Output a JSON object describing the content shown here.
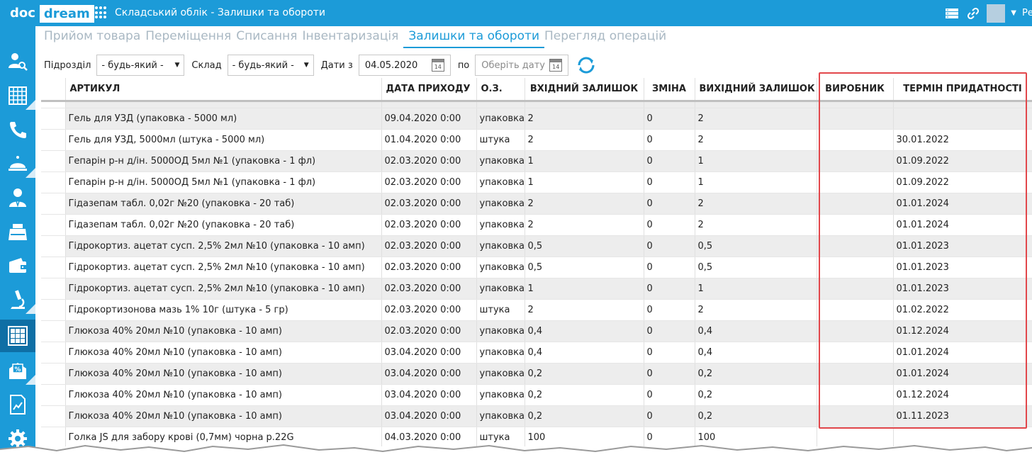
{
  "header": {
    "logo_doc": "doc",
    "logo_dream": "dream",
    "title": "Складський облік - Залишки та обороти",
    "user": "Ре"
  },
  "sidebar": {
    "items": [
      "user-search-icon",
      "calendar-grid-icon",
      "phone-icon",
      "service-bell-icon",
      "doctor-icon",
      "register-icon",
      "wallet-icon",
      "microscope-icon",
      "warehouse-icon",
      "discount-mail-icon",
      "report-icon",
      "gear-icon"
    ],
    "active_index": 8
  },
  "tabs": [
    {
      "label": "Прийом товара",
      "active": false
    },
    {
      "label": "Переміщення",
      "active": false
    },
    {
      "label": "Списання",
      "active": false
    },
    {
      "label": "Інвентаризація",
      "active": false
    },
    {
      "label": "Залишки та обороти",
      "active": true
    },
    {
      "label": "Перегляд операцій",
      "active": false
    }
  ],
  "filters": {
    "division_label": "Підрозділ",
    "division_value": "- будь-який -",
    "warehouse_label": "Склад",
    "warehouse_value": "- будь-який -",
    "date_from_label": "Дати з",
    "date_from_value": "04.05.2020",
    "date_to_label": "по",
    "date_to_placeholder": "Оберіть дату"
  },
  "table": {
    "columns": [
      "АРТИКУЛ",
      "ДАТА ПРИХОДУ",
      "О.З.",
      "ВХІДНИЙ ЗАЛИШОК",
      "ЗМІНА",
      "ВИХІДНИЙ ЗАЛИШОК",
      "ВИРОБНИК",
      "ТЕРМІН ПРИДАТНОСТІ"
    ],
    "rows": [
      [
        "Гель для УЗД (упаковка - 5000 мл)",
        "09.04.2020 0:00",
        "упаковка",
        "2",
        "0",
        "2",
        "",
        ""
      ],
      [
        "Гель для УЗД, 5000мл (штука - 5000 мл)",
        "01.04.2020 0:00",
        "штука",
        "2",
        "0",
        "2",
        "",
        "30.01.2022"
      ],
      [
        "Гепарін р-н д/ін. 5000ОД  5мл №1 (упаковка - 1 фл)",
        "02.03.2020 0:00",
        "упаковка",
        "1",
        "0",
        "1",
        "",
        "01.09.2022"
      ],
      [
        "Гепарін р-н д/ін. 5000ОД  5мл №1 (упаковка - 1 фл)",
        "02.03.2020 0:00",
        "упаковка",
        "1",
        "0",
        "1",
        "",
        "01.09.2022"
      ],
      [
        "Гідазепам табл. 0,02г №20 (упаковка - 20 таб)",
        "02.03.2020 0:00",
        "упаковка",
        "2",
        "0",
        "2",
        "",
        "01.01.2024"
      ],
      [
        "Гідазепам табл. 0,02г №20 (упаковка - 20 таб)",
        "02.03.2020 0:00",
        "упаковка",
        "2",
        "0",
        "2",
        "",
        "01.01.2024"
      ],
      [
        "Гідрокортиз. ацетат сусп. 2,5% 2мл №10 (упаковка - 10 амп)",
        "02.03.2020 0:00",
        "упаковка",
        "0,5",
        "0",
        "0,5",
        "",
        "01.01.2023"
      ],
      [
        "Гідрокортиз. ацетат сусп. 2,5% 2мл №10 (упаковка - 10 амп)",
        "02.03.2020 0:00",
        "упаковка",
        "0,5",
        "0",
        "0,5",
        "",
        "01.01.2023"
      ],
      [
        "Гідрокортиз. ацетат сусп. 2,5% 2мл №10 (упаковка - 10 амп)",
        "02.03.2020 0:00",
        "упаковка",
        "1",
        "0",
        "1",
        "",
        "01.01.2023"
      ],
      [
        "Гідрокортизонова мазь 1% 10г (штука - 5 гр)",
        "02.03.2020 0:00",
        "штука",
        "2",
        "0",
        "2",
        "",
        "01.02.2022"
      ],
      [
        "Глюкоза 40% 20мл №10 (упаковка - 10 амп)",
        "02.03.2020 0:00",
        "упаковка",
        "0,4",
        "0",
        "0,4",
        "",
        "01.12.2024"
      ],
      [
        "Глюкоза 40% 20мл №10 (упаковка - 10 амп)",
        "03.04.2020 0:00",
        "упаковка",
        "0,4",
        "0",
        "0,4",
        "",
        "01.01.2024"
      ],
      [
        "Глюкоза 40% 20мл №10 (упаковка - 10 амп)",
        "03.04.2020 0:00",
        "упаковка",
        "0,2",
        "0",
        "0,2",
        "",
        "01.01.2024"
      ],
      [
        "Глюкоза 40% 20мл №10 (упаковка - 10 амп)",
        "03.04.2020 0:00",
        "упаковка",
        "0,2",
        "0",
        "0,2",
        "",
        "01.12.2024"
      ],
      [
        "Глюкоза 40% 20мл №10 (упаковка - 10 амп)",
        "03.04.2020 0:00",
        "упаковка",
        "0,2",
        "0",
        "0,2",
        "",
        "01.11.2023"
      ],
      [
        "Голка JS для забору крові (0,7мм) чорна р.22G",
        "04.03.2020 0:00",
        "штука",
        "100",
        "0",
        "100",
        "",
        ""
      ]
    ]
  },
  "colors": {
    "brand": "#1c9bd8",
    "highlight": "#e2474b",
    "row_alt": "#ededed"
  }
}
